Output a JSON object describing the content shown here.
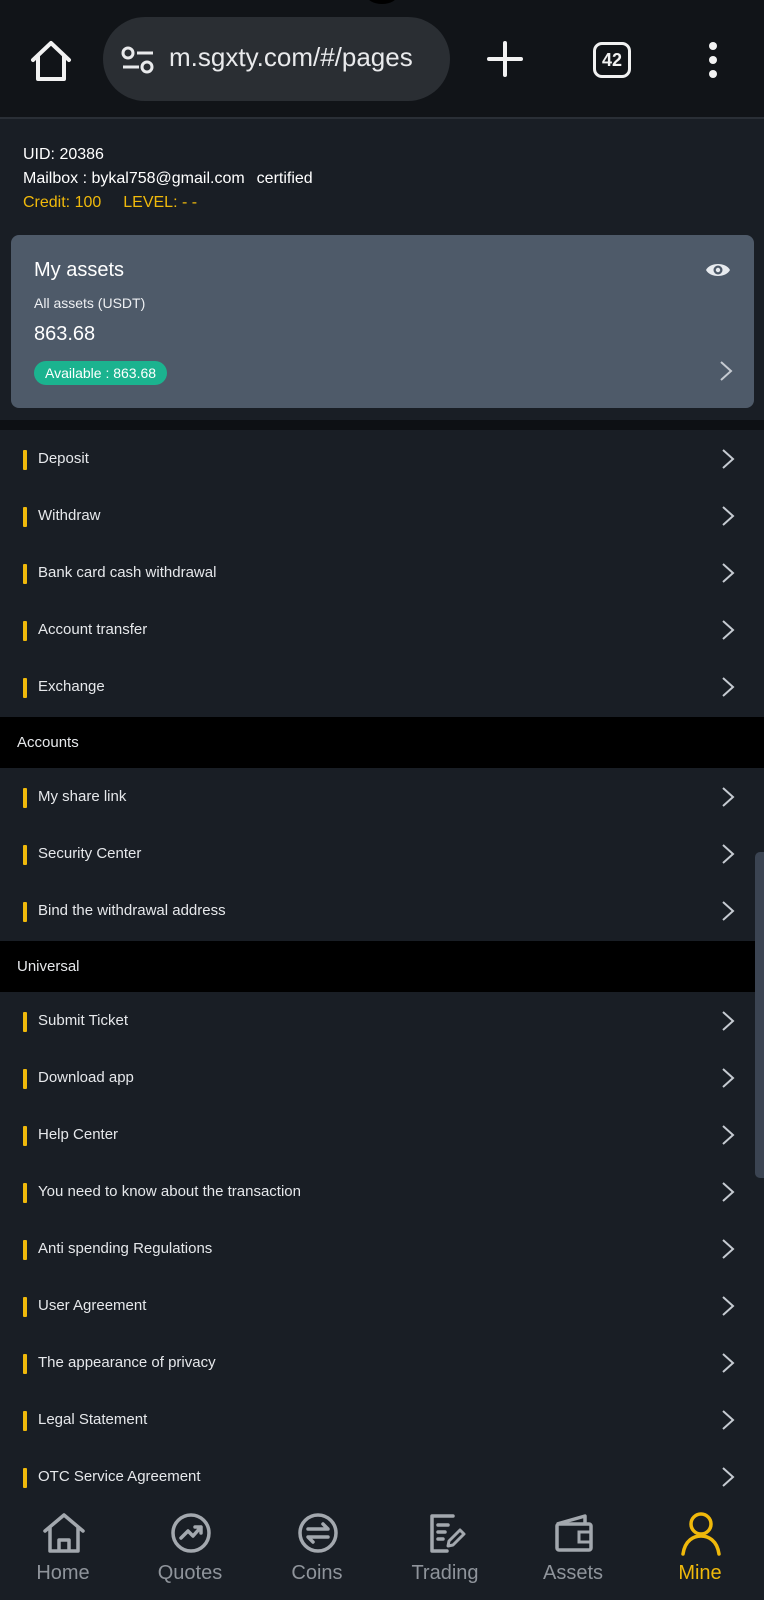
{
  "browser": {
    "url": "m.sgxty.com/#/pages",
    "tab_count": "42"
  },
  "user": {
    "uid": "UID: 20386",
    "mailbox": "Mailbox : bykal758@gmail.com",
    "status": "certified",
    "credit": "Credit: 100",
    "level": "LEVEL: - -"
  },
  "assets": {
    "title": "My assets",
    "subtitle": "All assets (USDT)",
    "total": "863.68",
    "available": "Available : 863.68"
  },
  "menu_main": [
    {
      "label": "Deposit"
    },
    {
      "label": "Withdraw"
    },
    {
      "label": "Bank card cash withdrawal"
    },
    {
      "label": "Account transfer"
    },
    {
      "label": "Exchange"
    }
  ],
  "section_accounts": {
    "title": "Accounts",
    "items": [
      {
        "label": "My share link"
      },
      {
        "label": "Security Center"
      },
      {
        "label": "Bind the withdrawal address"
      }
    ]
  },
  "section_universal": {
    "title": "Universal",
    "items": [
      {
        "label": "Submit Ticket"
      },
      {
        "label": "Download app"
      },
      {
        "label": "Help Center"
      },
      {
        "label": "You need to know about the transaction"
      },
      {
        "label": "Anti spending Regulations"
      },
      {
        "label": "User Agreement"
      },
      {
        "label": "The appearance of privacy"
      },
      {
        "label": "Legal Statement"
      },
      {
        "label": "OTC Service Agreement"
      }
    ]
  },
  "nav": {
    "items": [
      {
        "label": "Home",
        "icon": "home-icon"
      },
      {
        "label": "Quotes",
        "icon": "chart-trend-icon"
      },
      {
        "label": "Coins",
        "icon": "exchange-circle-icon"
      },
      {
        "label": "Trading",
        "icon": "document-edit-icon"
      },
      {
        "label": "Assets",
        "icon": "wallet-icon"
      },
      {
        "label": "Mine",
        "icon": "user-icon"
      }
    ],
    "active": "Mine"
  },
  "colors": {
    "accent": "#f0b90b",
    "available_badge": "#1bb38f",
    "background": "#191e25",
    "card": "#4e5a69"
  }
}
